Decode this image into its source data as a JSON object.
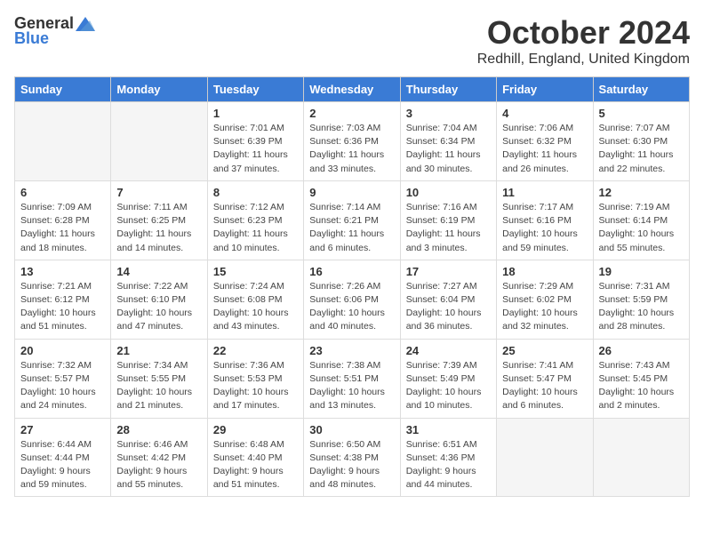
{
  "logo": {
    "general": "General",
    "blue": "Blue"
  },
  "title": "October 2024",
  "location": "Redhill, England, United Kingdom",
  "days_of_week": [
    "Sunday",
    "Monday",
    "Tuesday",
    "Wednesday",
    "Thursday",
    "Friday",
    "Saturday"
  ],
  "weeks": [
    [
      {
        "day": "",
        "sunrise": "",
        "sunset": "",
        "daylight": ""
      },
      {
        "day": "",
        "sunrise": "",
        "sunset": "",
        "daylight": ""
      },
      {
        "day": "1",
        "sunrise": "Sunrise: 7:01 AM",
        "sunset": "Sunset: 6:39 PM",
        "daylight": "Daylight: 11 hours and 37 minutes."
      },
      {
        "day": "2",
        "sunrise": "Sunrise: 7:03 AM",
        "sunset": "Sunset: 6:36 PM",
        "daylight": "Daylight: 11 hours and 33 minutes."
      },
      {
        "day": "3",
        "sunrise": "Sunrise: 7:04 AM",
        "sunset": "Sunset: 6:34 PM",
        "daylight": "Daylight: 11 hours and 30 minutes."
      },
      {
        "day": "4",
        "sunrise": "Sunrise: 7:06 AM",
        "sunset": "Sunset: 6:32 PM",
        "daylight": "Daylight: 11 hours and 26 minutes."
      },
      {
        "day": "5",
        "sunrise": "Sunrise: 7:07 AM",
        "sunset": "Sunset: 6:30 PM",
        "daylight": "Daylight: 11 hours and 22 minutes."
      }
    ],
    [
      {
        "day": "6",
        "sunrise": "Sunrise: 7:09 AM",
        "sunset": "Sunset: 6:28 PM",
        "daylight": "Daylight: 11 hours and 18 minutes."
      },
      {
        "day": "7",
        "sunrise": "Sunrise: 7:11 AM",
        "sunset": "Sunset: 6:25 PM",
        "daylight": "Daylight: 11 hours and 14 minutes."
      },
      {
        "day": "8",
        "sunrise": "Sunrise: 7:12 AM",
        "sunset": "Sunset: 6:23 PM",
        "daylight": "Daylight: 11 hours and 10 minutes."
      },
      {
        "day": "9",
        "sunrise": "Sunrise: 7:14 AM",
        "sunset": "Sunset: 6:21 PM",
        "daylight": "Daylight: 11 hours and 6 minutes."
      },
      {
        "day": "10",
        "sunrise": "Sunrise: 7:16 AM",
        "sunset": "Sunset: 6:19 PM",
        "daylight": "Daylight: 11 hours and 3 minutes."
      },
      {
        "day": "11",
        "sunrise": "Sunrise: 7:17 AM",
        "sunset": "Sunset: 6:16 PM",
        "daylight": "Daylight: 10 hours and 59 minutes."
      },
      {
        "day": "12",
        "sunrise": "Sunrise: 7:19 AM",
        "sunset": "Sunset: 6:14 PM",
        "daylight": "Daylight: 10 hours and 55 minutes."
      }
    ],
    [
      {
        "day": "13",
        "sunrise": "Sunrise: 7:21 AM",
        "sunset": "Sunset: 6:12 PM",
        "daylight": "Daylight: 10 hours and 51 minutes."
      },
      {
        "day": "14",
        "sunrise": "Sunrise: 7:22 AM",
        "sunset": "Sunset: 6:10 PM",
        "daylight": "Daylight: 10 hours and 47 minutes."
      },
      {
        "day": "15",
        "sunrise": "Sunrise: 7:24 AM",
        "sunset": "Sunset: 6:08 PM",
        "daylight": "Daylight: 10 hours and 43 minutes."
      },
      {
        "day": "16",
        "sunrise": "Sunrise: 7:26 AM",
        "sunset": "Sunset: 6:06 PM",
        "daylight": "Daylight: 10 hours and 40 minutes."
      },
      {
        "day": "17",
        "sunrise": "Sunrise: 7:27 AM",
        "sunset": "Sunset: 6:04 PM",
        "daylight": "Daylight: 10 hours and 36 minutes."
      },
      {
        "day": "18",
        "sunrise": "Sunrise: 7:29 AM",
        "sunset": "Sunset: 6:02 PM",
        "daylight": "Daylight: 10 hours and 32 minutes."
      },
      {
        "day": "19",
        "sunrise": "Sunrise: 7:31 AM",
        "sunset": "Sunset: 5:59 PM",
        "daylight": "Daylight: 10 hours and 28 minutes."
      }
    ],
    [
      {
        "day": "20",
        "sunrise": "Sunrise: 7:32 AM",
        "sunset": "Sunset: 5:57 PM",
        "daylight": "Daylight: 10 hours and 24 minutes."
      },
      {
        "day": "21",
        "sunrise": "Sunrise: 7:34 AM",
        "sunset": "Sunset: 5:55 PM",
        "daylight": "Daylight: 10 hours and 21 minutes."
      },
      {
        "day": "22",
        "sunrise": "Sunrise: 7:36 AM",
        "sunset": "Sunset: 5:53 PM",
        "daylight": "Daylight: 10 hours and 17 minutes."
      },
      {
        "day": "23",
        "sunrise": "Sunrise: 7:38 AM",
        "sunset": "Sunset: 5:51 PM",
        "daylight": "Daylight: 10 hours and 13 minutes."
      },
      {
        "day": "24",
        "sunrise": "Sunrise: 7:39 AM",
        "sunset": "Sunset: 5:49 PM",
        "daylight": "Daylight: 10 hours and 10 minutes."
      },
      {
        "day": "25",
        "sunrise": "Sunrise: 7:41 AM",
        "sunset": "Sunset: 5:47 PM",
        "daylight": "Daylight: 10 hours and 6 minutes."
      },
      {
        "day": "26",
        "sunrise": "Sunrise: 7:43 AM",
        "sunset": "Sunset: 5:45 PM",
        "daylight": "Daylight: 10 hours and 2 minutes."
      }
    ],
    [
      {
        "day": "27",
        "sunrise": "Sunrise: 6:44 AM",
        "sunset": "Sunset: 4:44 PM",
        "daylight": "Daylight: 9 hours and 59 minutes."
      },
      {
        "day": "28",
        "sunrise": "Sunrise: 6:46 AM",
        "sunset": "Sunset: 4:42 PM",
        "daylight": "Daylight: 9 hours and 55 minutes."
      },
      {
        "day": "29",
        "sunrise": "Sunrise: 6:48 AM",
        "sunset": "Sunset: 4:40 PM",
        "daylight": "Daylight: 9 hours and 51 minutes."
      },
      {
        "day": "30",
        "sunrise": "Sunrise: 6:50 AM",
        "sunset": "Sunset: 4:38 PM",
        "daylight": "Daylight: 9 hours and 48 minutes."
      },
      {
        "day": "31",
        "sunrise": "Sunrise: 6:51 AM",
        "sunset": "Sunset: 4:36 PM",
        "daylight": "Daylight: 9 hours and 44 minutes."
      },
      {
        "day": "",
        "sunrise": "",
        "sunset": "",
        "daylight": ""
      },
      {
        "day": "",
        "sunrise": "",
        "sunset": "",
        "daylight": ""
      }
    ]
  ]
}
